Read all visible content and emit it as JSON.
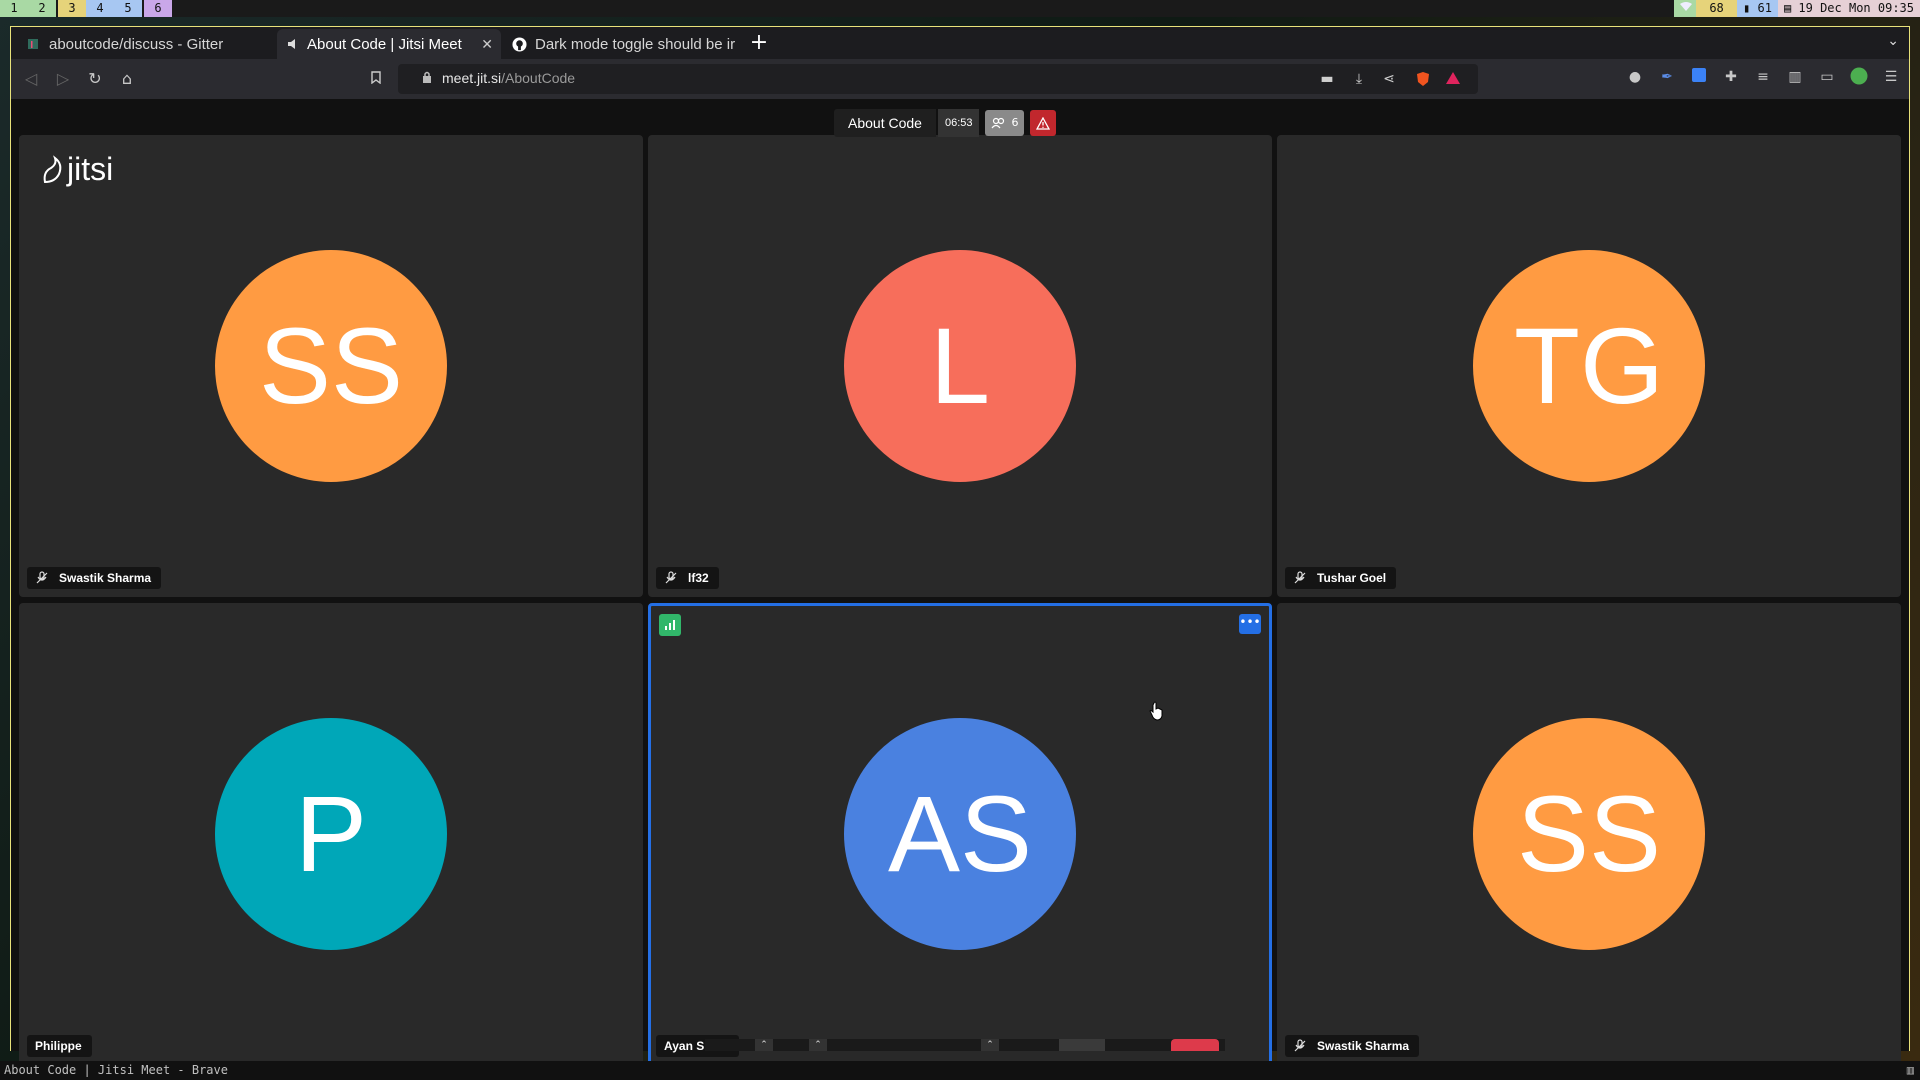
{
  "workspaces": [
    {
      "label": "1",
      "color": "#a9d9a4"
    },
    {
      "label": "2",
      "color": "#a9d9a4"
    },
    {
      "label": "3",
      "color": "#e6d37a"
    },
    {
      "label": "4",
      "color": "#a7c7f2"
    },
    {
      "label": "5",
      "color": "#a7c7f2"
    },
    {
      "label": "6",
      "color": "#c9a7e9"
    }
  ],
  "status": {
    "volume": "68",
    "battery": "61",
    "datetime": "19 Dec Mon 09:35"
  },
  "tabs": [
    {
      "label": "aboutcode/discuss - Gitter"
    },
    {
      "label": "About Code | Jitsi Meet"
    },
    {
      "label": "Dark mode toggle should be ir"
    }
  ],
  "url": {
    "domain": "meet.jit.si",
    "path": "/AboutCode"
  },
  "meeting": {
    "logo": "jitsi",
    "subject": "About Code",
    "timer": "06:53",
    "participant_count": "6"
  },
  "participants": [
    {
      "name": "Swastik Sharma",
      "initials": "SS",
      "color": "#ff9b42",
      "muted": true
    },
    {
      "name": "lf32",
      "initials": "L",
      "color": "#f76e5b",
      "muted": true
    },
    {
      "name": "Tushar Goel",
      "initials": "TG",
      "color": "#ff9b42",
      "muted": true
    },
    {
      "name": "Philippe",
      "initials": "P",
      "color": "#00a7b8",
      "muted": false
    },
    {
      "name": "Ayan Sinha",
      "initials": "AS",
      "color": "#4a81e0",
      "muted": false
    },
    {
      "name": "Swastik Sharma",
      "initials": "SS",
      "color": "#ff9b42",
      "muted": true
    }
  ],
  "window_title": "About Code | Jitsi Meet - Brave",
  "colors": {
    "dominant_border": "#246fe5",
    "connection_good": "#31b76a",
    "warning": "#c1272d"
  }
}
